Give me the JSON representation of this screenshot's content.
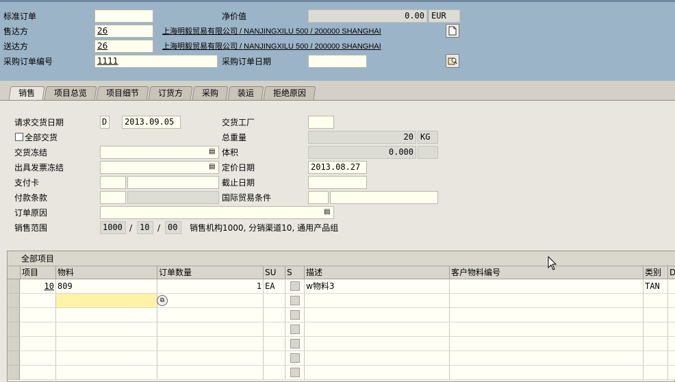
{
  "header": {
    "std_order_label": "标准订单",
    "std_order_value": "",
    "net_value_label": "净价值",
    "net_value": "0.00",
    "currency": "EUR",
    "sold_to_label": "售达方",
    "sold_to_value": "26",
    "sold_to_address": "上海明毅贸易有限公司 / NANJINGXILU 500 / 200000 SHANGHAI",
    "ship_to_label": "送达方",
    "ship_to_value": "26",
    "ship_to_address": "上海明毅贸易有限公司 / NANJINGXILU 500 / 200000 SHANGHAI",
    "po_number_label": "采购订单编号",
    "po_number_value": "1111",
    "po_date_label": "采购订单日期",
    "po_date_value": ""
  },
  "tabs": [
    "销售",
    "项目总览",
    "项目细节",
    "订货方",
    "采购",
    "装运",
    "拒绝原因"
  ],
  "sales": {
    "req_delivery_date_label": "请求交货日期",
    "req_delivery_date_type": "D",
    "req_delivery_date": "2013.09.05",
    "delivery_plant_label": "交货工厂",
    "delivery_plant_value": "",
    "complete_delivery_label": "全部交货",
    "total_weight_label": "总重量",
    "total_weight": "20",
    "weight_unit": "KG",
    "delivery_block_label": "交货冻结",
    "volume_label": "体积",
    "volume": "0.000",
    "billing_block_label": "出具发票冻结",
    "pricing_date_label": "定价日期",
    "pricing_date": "2013.08.27",
    "payment_card_label": "支付卡",
    "expiry_date_label": "截止日期",
    "payment_terms_label": "付款条款",
    "incoterms_label": "国际贸易条件",
    "order_reason_label": "订单原因",
    "sales_area_label": "销售范围",
    "sales_org": "1000",
    "dist_channel": "10",
    "division": "00",
    "sep": "/",
    "sales_area_desc": "销售机构1000, 分销渠道10, 通用产品组"
  },
  "table": {
    "title": "全部项目",
    "columns": [
      "项目",
      "物料",
      "订单数量",
      "SU",
      "S",
      "描述",
      "客户物料编号",
      "类别",
      "D("
    ],
    "rows": [
      {
        "item": "10",
        "material": "809",
        "qty": "1",
        "su": "EA",
        "desc": "w物料3",
        "cust_mat": "",
        "cat": "TAN"
      }
    ]
  },
  "icons": {
    "doc": "document-icon",
    "display": "display-icon",
    "list": "list-select-icon"
  }
}
